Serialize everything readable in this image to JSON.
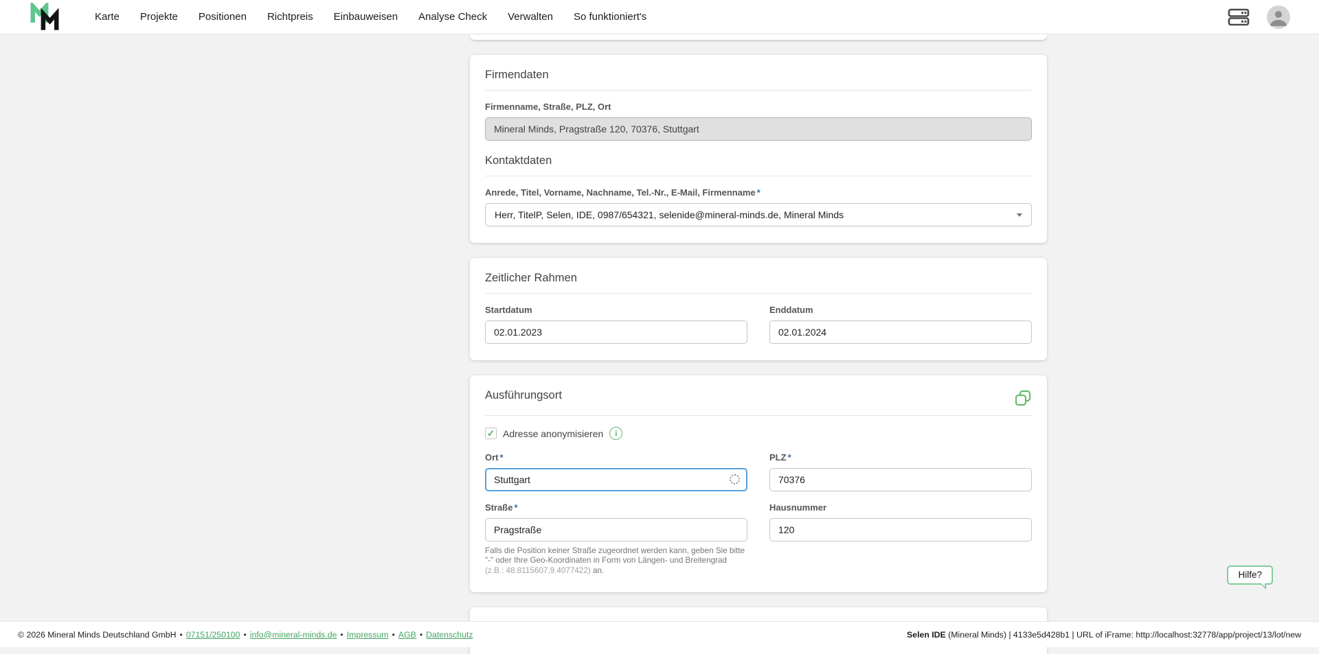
{
  "nav": {
    "items": [
      "Karte",
      "Projekte",
      "Positionen",
      "Richtpreis",
      "Einbauweisen",
      "Analyse Check",
      "Verwalten",
      "So funktioniert's"
    ]
  },
  "misc": {
    "required_marker": "*"
  },
  "icons": {
    "check": "✓",
    "info": "i"
  },
  "firmendaten": {
    "title": "Firmendaten",
    "company_label": "Firmenname, Straße, PLZ, Ort",
    "company_value": "Mineral Minds, Pragstraße 120, 70376, Stuttgart",
    "kontakt_title": "Kontaktdaten",
    "contact_label": "Anrede, Titel, Vorname, Nachname, Tel.-Nr., E-Mail, Firmenname",
    "contact_value": "Herr, TitelP, Selen, IDE, 0987/654321, selenide@mineral-minds.de, Mineral Minds"
  },
  "zeitraum": {
    "title": "Zeitlicher Rahmen",
    "start_label": "Startdatum",
    "start_value": "02.01.2023",
    "end_label": "Enddatum",
    "end_value": "02.01.2024"
  },
  "ausfuehrungsort": {
    "title": "Ausführungsort",
    "anonymize_label": "Adresse anonymisieren",
    "ort_label": "Ort",
    "ort_value": "Stuttgart",
    "plz_label": "PLZ",
    "plz_value": "70376",
    "strasse_label": "Straße",
    "strasse_value": "Pragstraße",
    "hausnummer_label": "Hausnummer",
    "hausnummer_value": "120",
    "helper_part1": "Falls die Position keiner Straße zugeordnet werden kann, geben Sie bitte \"-\" oder Ihre Geo-Koordinaten in Form von Längen- und Breitengrad ",
    "helper_example": "(z.B.: 48.8115607,9.4077422)",
    "helper_part2": " an."
  },
  "help": {
    "label": "Hilfe?"
  },
  "footer": {
    "copyright": "© 2026 Mineral Minds Deutschland GmbH",
    "separator": "•",
    "phone_link": "07151/250100",
    "email_link": "info@mineral-minds.de",
    "impressum_link": "Impressum",
    "agb_link": "AGB",
    "datenschutz_link": "Datenschutz",
    "right_bold": "Selen IDE",
    "right_rest": " (Mineral Minds) | 4133e5d428b1 | URL of iFrame: http://localhost:32778/app/project/13/lot/new"
  },
  "colors": {
    "accent_green": "#5fc68e",
    "icon_green": "#66bb6a",
    "link_green": "#43a564",
    "focus_blue": "#58a0da",
    "required_blue": "#3b6db5"
  }
}
